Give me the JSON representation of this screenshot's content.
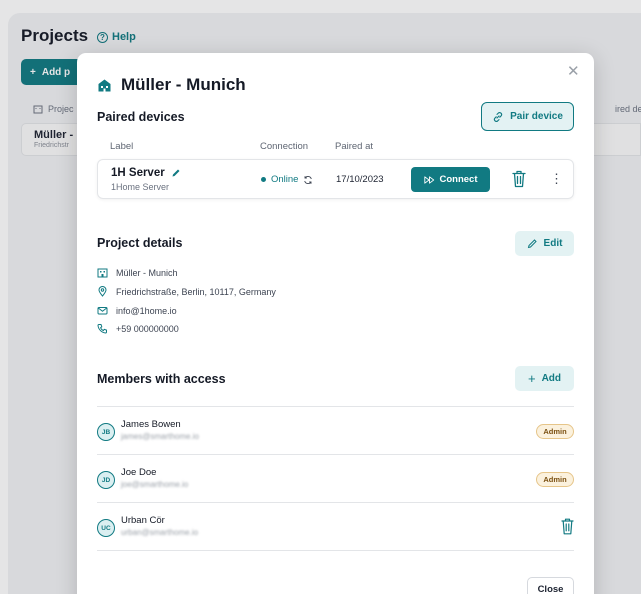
{
  "background": {
    "title": "Projects",
    "help_label": "Help",
    "add_project_label": "Add p",
    "table_header_project": "Projec",
    "table_header_paired": "ired device",
    "row_name": "Müller -",
    "row_sub": "Friedrichstr"
  },
  "modal": {
    "title": "Müller - Munich",
    "paired_devices": {
      "section_title": "Paired devices",
      "pair_button": "Pair device",
      "columns": {
        "label": "Label",
        "connection": "Connection",
        "paired_at": "Paired at"
      },
      "device": {
        "name": "1H Server",
        "type": "1Home Server",
        "status": "Online",
        "paired_at": "17/10/2023",
        "connect_label": "Connect"
      }
    },
    "project_details": {
      "section_title": "Project details",
      "edit_label": "Edit",
      "name": "Müller - Munich",
      "address": "Friedrichstraße, Berlin, 10117, Germany",
      "email": "info@1home.io",
      "phone": "+59 000000000"
    },
    "members": {
      "section_title": "Members with access",
      "add_label": "Add",
      "list": [
        {
          "initials": "JB",
          "name": "James Bowen",
          "email": "james@smarthome.io",
          "role": "Admin"
        },
        {
          "initials": "JD",
          "name": "Joe Doe",
          "email": "joe@smarthome.io",
          "role": "Admin"
        },
        {
          "initials": "UC",
          "name": "Urban Cör",
          "email": "urban@smarthome.io",
          "role": ""
        }
      ]
    },
    "close_label": "Close"
  },
  "colors": {
    "accent": "#117a82",
    "accent_light": "#e3f2f3",
    "admin_badge": "#fbf1dd"
  }
}
